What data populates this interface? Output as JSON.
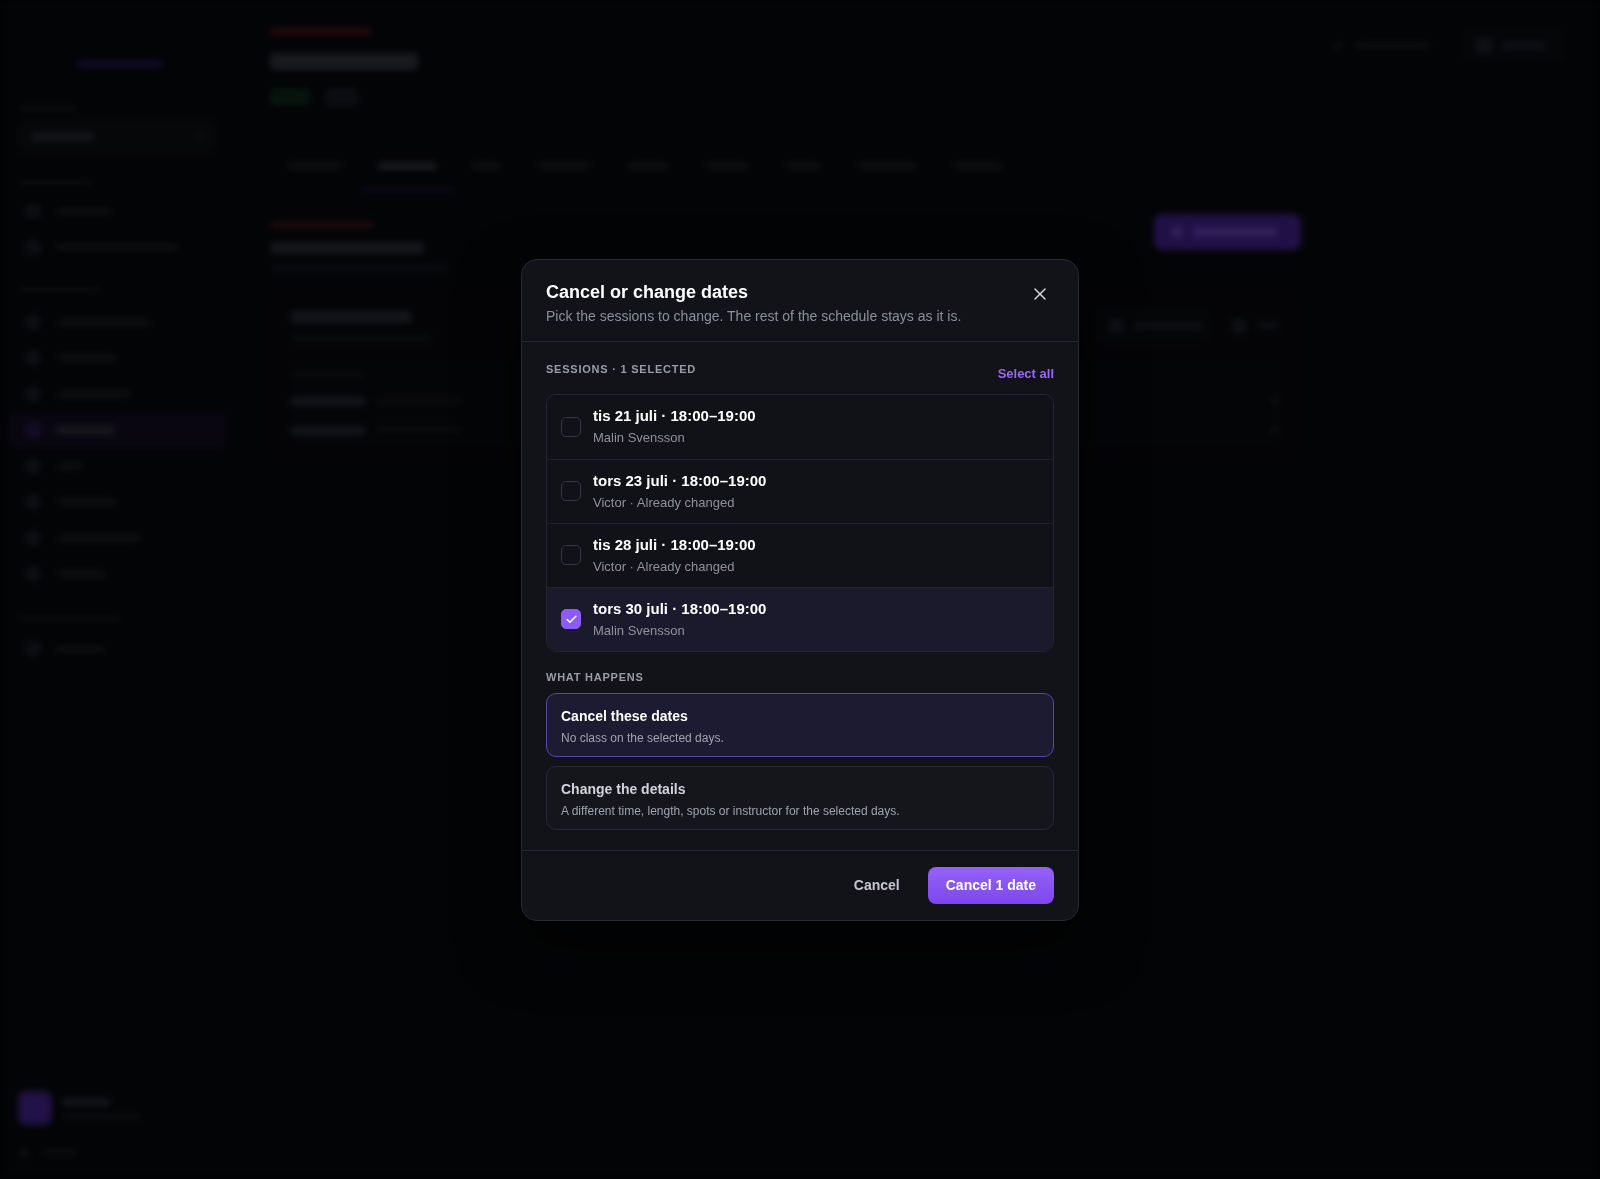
{
  "dialog": {
    "title": "Cancel or change dates",
    "subtitle": "Pick the sessions to change. The rest of the schedule stays as it is.",
    "sessions_label": "SESSIONS · 1 SELECTED",
    "select_all": "Select all",
    "sessions": [
      {
        "date": "tis 21 juli · 18:00–19:00",
        "details": "Malin Svensson",
        "selected": false
      },
      {
        "date": "tors 23 juli · 18:00–19:00",
        "details": "Victor · Already changed",
        "selected": false
      },
      {
        "date": "tis 28 juli · 18:00–19:00",
        "details": "Victor · Already changed",
        "selected": false
      },
      {
        "date": "tors 30 juli · 18:00–19:00",
        "details": "Malin Svensson",
        "selected": true
      }
    ],
    "what_happens_label": "WHAT HAPPENS",
    "options": [
      {
        "title": "Cancel these dates",
        "description": "No class on the selected days.",
        "selected": true
      },
      {
        "title": "Change the details",
        "description": "A different time, length, spots or instructor for the selected days.",
        "selected": false
      }
    ],
    "cancel_button": "Cancel",
    "confirm_button": "Cancel 1 date"
  }
}
